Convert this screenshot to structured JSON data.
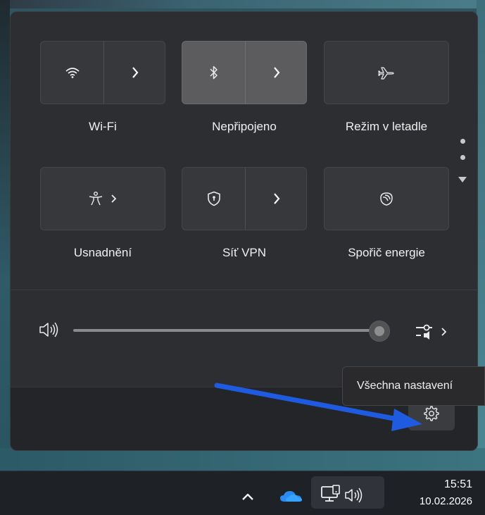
{
  "quick_settings": {
    "row1": [
      {
        "label": "Wi-Fi",
        "icon": "wifi-icon",
        "expandable": true,
        "active": false
      },
      {
        "label": "Nepřipojeno",
        "icon": "bluetooth-icon",
        "expandable": true,
        "active": true
      },
      {
        "label": "Režim v letadle",
        "icon": "airplane-icon",
        "expandable": false,
        "active": false
      }
    ],
    "row2": [
      {
        "label": "Usnadnění",
        "icon": "accessibility-icon",
        "expandable": true,
        "active": false
      },
      {
        "label": "Síť VPN",
        "icon": "vpn-shield-icon",
        "expandable": true,
        "active": false
      },
      {
        "label": "Spořič energie",
        "icon": "leaf-icon",
        "expandable": false,
        "active": false
      }
    ],
    "volume": {
      "icon": "speaker-icon",
      "level_percent": 100
    },
    "settings_tooltip": "Všechna nastavení"
  },
  "taskbar": {
    "time": "15:51",
    "date": "10.02.2026",
    "tray_icons": [
      "chevron-up-icon",
      "onedrive-cloud-icon",
      "network-icon",
      "speaker-icon"
    ]
  },
  "colors": {
    "panel_bg": "#2c2e31",
    "tile_bg": "#36383c",
    "tile_active_bg": "#5c5c5e",
    "annotation_arrow": "#1f5be0"
  }
}
